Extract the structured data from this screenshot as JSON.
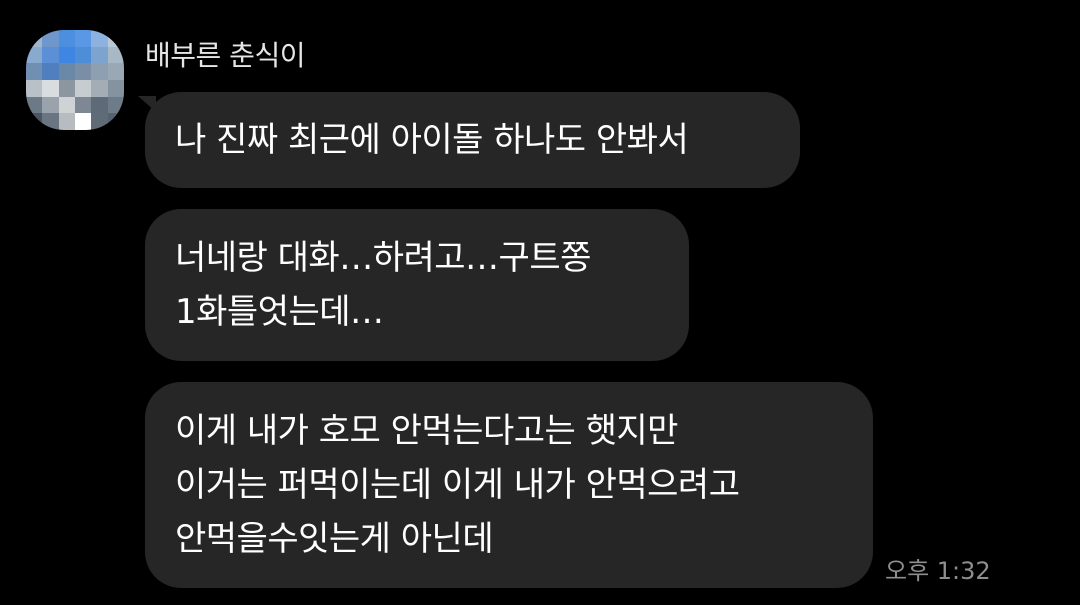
{
  "sender": {
    "name": "배부른 춘식이"
  },
  "avatar_pixels": [
    "#9fb6cf",
    "#6f97cc",
    "#4c8ee0",
    "#5a98e6",
    "#8db2df",
    "#b9c8d6",
    "#8aa9cf",
    "#5b8fd6",
    "#3f86e2",
    "#4e8ed8",
    "#7da3cf",
    "#a9b8c7",
    "#6f8fb3",
    "#4f7fbf",
    "#6a88a8",
    "#7a8fa5",
    "#8f9fb2",
    "#9aa7b4",
    "#b8c0c8",
    "#d9dde0",
    "#8b96a1",
    "#c7ccd0",
    "#a4adb5",
    "#8593a0",
    "#6c7a88",
    "#9aa3ab",
    "#cfd3d6",
    "#7d8894",
    "#5d6b79",
    "#6e7c89",
    "#4a5663",
    "#6a7581",
    "#b7bcc0",
    "#ffffff",
    "#5f6b77",
    "#56626e"
  ],
  "messages": [
    {
      "lines": [
        "나 진짜 최근에 아이돌 하나도 안봐서"
      ]
    },
    {
      "lines": [
        "너네랑 대화…하려고…구트쫑",
        "1화틀엇는데…"
      ]
    },
    {
      "lines": [
        "이게 내가 호모 안먹는다고는 햇지만",
        "이거는 퍼먹이는데 이게 내가 안먹으려고",
        "안먹을수잇는게 아닌데"
      ]
    }
  ],
  "timestamp": "오후 1:32",
  "colors": {
    "background": "#000000",
    "bubble": "#262626",
    "text": "#ffffff",
    "timestamp": "#8e8e8e"
  }
}
